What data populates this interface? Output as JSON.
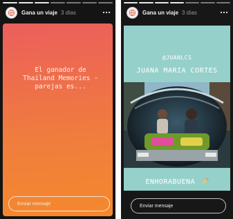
{
  "stories": [
    {
      "username": "Gana un viaje",
      "time": "3 días",
      "text": "El ganador de\nThailand Memories -\nparejas es...",
      "message_placeholder": "Enviar mensaje"
    },
    {
      "username": "Gana un viaje",
      "time": "3 días",
      "handle": "@JUANLCS",
      "name": "JUANA MARIA CORTES",
      "congrats": "ENHORABUENA",
      "message_placeholder": "Enviar mensaje"
    }
  ],
  "icons": {
    "avatar": "globe-logo-icon",
    "more": "more-options-icon",
    "party": "party-popper-icon"
  },
  "colors": {
    "gradient_start": "#ec5f5c",
    "gradient_end": "#f4892d",
    "teal": "#96d0cb"
  }
}
